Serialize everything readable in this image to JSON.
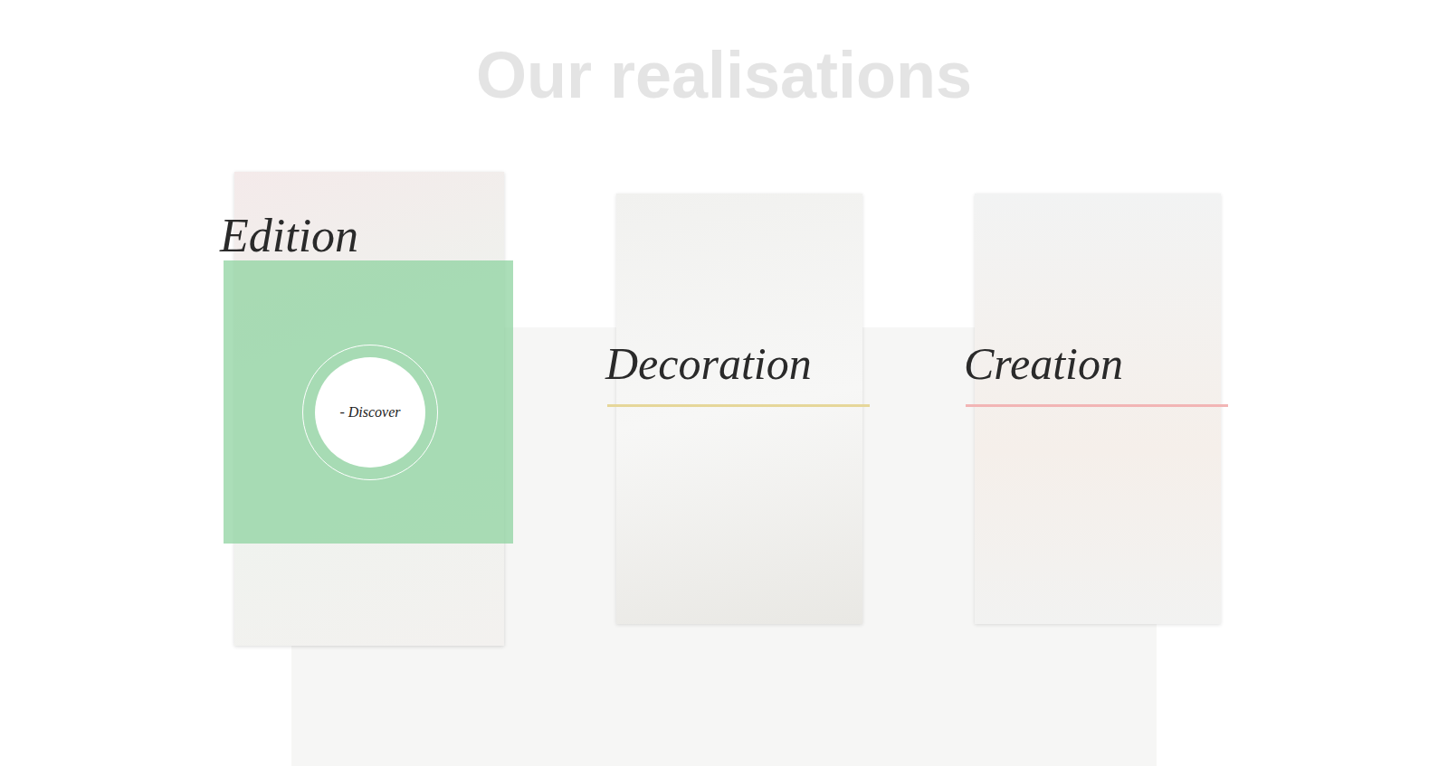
{
  "page": {
    "title": "Our realisations"
  },
  "cards": [
    {
      "label": "Edition",
      "selected": true,
      "action": "- Discover",
      "color": "#8fd3a0"
    },
    {
      "label": "Decoration",
      "selected": false,
      "action": "",
      "color": "#e6d79a"
    },
    {
      "label": "Creation",
      "selected": false,
      "action": "",
      "color": "#f2b5b5"
    }
  ]
}
